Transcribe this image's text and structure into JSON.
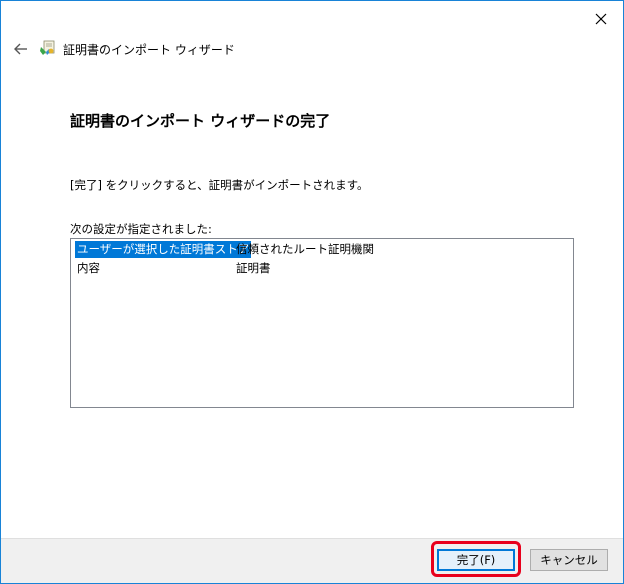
{
  "wizard": {
    "title": "証明書のインポート ウィザード",
    "heading": "証明書のインポート ウィザードの完了",
    "description": "[完了] をクリックすると、証明書がインポートされます。",
    "settings_label": "次の設定が指定されました:"
  },
  "settings": {
    "rows": [
      {
        "key": "ユーザーが選択した証明書ストア",
        "value": "信頼されたルート証明機関",
        "selected": true
      },
      {
        "key": "内容",
        "value": "証明書",
        "selected": false
      }
    ]
  },
  "buttons": {
    "finish": "完了(F)",
    "cancel": "キャンセル"
  },
  "icons": {
    "back": "arrow-left-icon",
    "close": "close-icon",
    "wizard": "certificate-wizard-icon"
  },
  "colors": {
    "selection": "#0078d7",
    "window_border": "#1883d7",
    "annotation_highlight": "#e8001c"
  }
}
